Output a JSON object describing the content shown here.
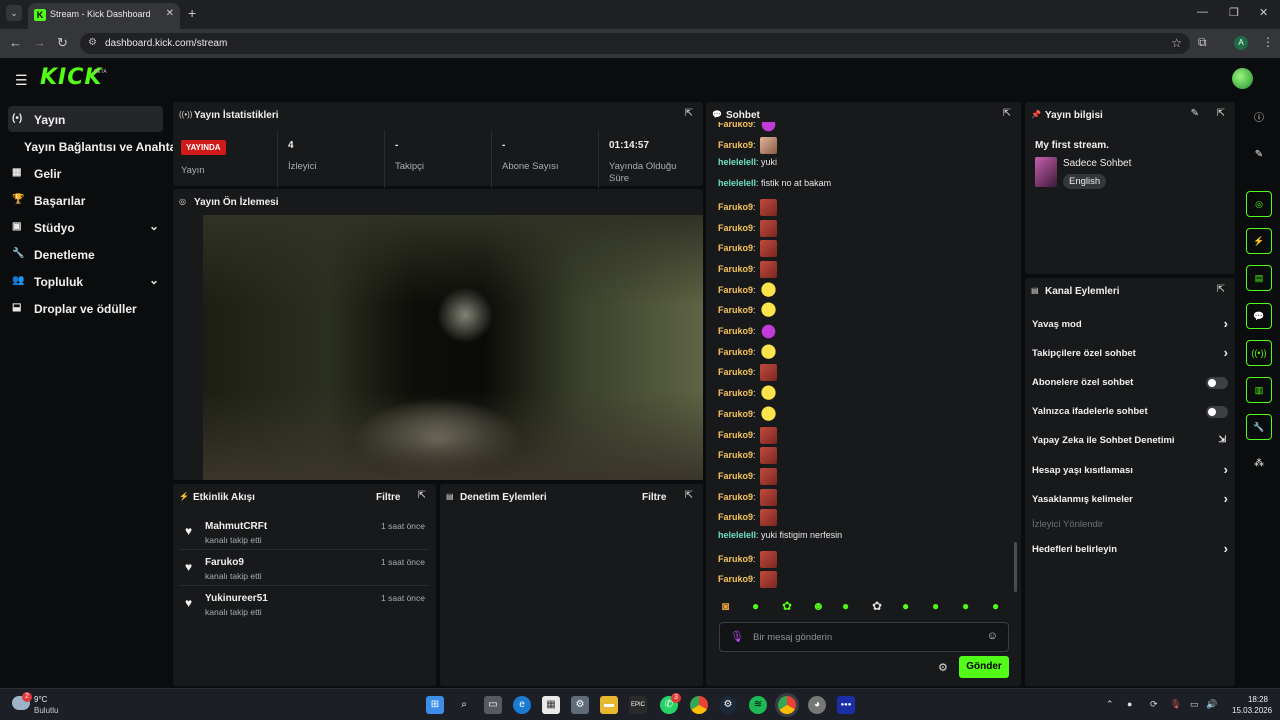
{
  "browser": {
    "tab_title": "Stream - Kick Dashboard",
    "url": "dashboard.kick.com/stream",
    "profile_initial": "A"
  },
  "brand": {
    "logo": "KICK",
    "beta": "BETA",
    "accent": "#53fc18"
  },
  "sidebar": {
    "items": [
      {
        "label": "Yayın",
        "icon": "broadcast-icon",
        "active": true
      },
      {
        "label": "Yayın Bağlantısı ve Anahtarı",
        "icon": "",
        "active": false
      },
      {
        "label": "Gelir",
        "icon": "revenue-icon",
        "active": false
      },
      {
        "label": "Başarılar",
        "icon": "trophy-icon",
        "active": false
      },
      {
        "label": "Stüdyo",
        "icon": "studio-icon",
        "active": false,
        "expandable": true
      },
      {
        "label": "Denetleme",
        "icon": "wrench-icon",
        "active": false
      },
      {
        "label": "Topluluk",
        "icon": "community-icon",
        "active": false,
        "expandable": true
      },
      {
        "label": "Droplar ve ödüller",
        "icon": "gift-icon",
        "active": false
      }
    ]
  },
  "stats": {
    "title": "Yayın İstatistikleri",
    "live_badge": "YAYINDA",
    "live_label": "Yayın",
    "cells": [
      {
        "value": "4",
        "label": "İzleyici"
      },
      {
        "value": "-",
        "label": "Takipçi"
      },
      {
        "value": "-",
        "label": "Abone Sayısı"
      },
      {
        "value": "01:14:57",
        "label": "Yayında Olduğu Süre"
      }
    ]
  },
  "preview": {
    "title": "Yayın Ön İzlemesi"
  },
  "activity": {
    "title": "Etkinlik Akışı",
    "filter": "Filtre",
    "events": [
      {
        "name": "MahmutCRFt",
        "action": "kanalı takip etti",
        "time": "1 saat önce"
      },
      {
        "name": "Faruko9",
        "action": "kanalı takip etti",
        "time": "1 saat önce"
      },
      {
        "name": "Yukinureer51",
        "action": "kanalı takip etti",
        "time": "1 saat önce"
      }
    ]
  },
  "moderation": {
    "title": "Denetim Eylemleri",
    "filter": "Filtre"
  },
  "chat": {
    "title": "Sohbet",
    "messages": [
      {
        "user": "Faruko9",
        "type": "f",
        "text": "",
        "emote": "em-pink"
      },
      {
        "user": "Faruko9",
        "type": "f",
        "text": "",
        "emote": "em-face"
      },
      {
        "user": "helelelell",
        "type": "h",
        "text": "yuki",
        "emote": ""
      },
      {
        "user": "helelelell",
        "type": "h",
        "text": "fistik no at bakam",
        "emote": ""
      },
      {
        "user": "Faruko9",
        "type": "f",
        "text": "",
        "emote": "em-cat"
      },
      {
        "user": "Faruko9",
        "type": "f",
        "text": "",
        "emote": "em-cat"
      },
      {
        "user": "Faruko9",
        "type": "f",
        "text": "",
        "emote": "em-cat"
      },
      {
        "user": "Faruko9",
        "type": "f",
        "text": "",
        "emote": "em-cat"
      },
      {
        "user": "Faruko9",
        "type": "f",
        "text": "",
        "emote": "em-blob"
      },
      {
        "user": "Faruko9",
        "type": "f",
        "text": "",
        "emote": "em-blob"
      },
      {
        "user": "Faruko9",
        "type": "f",
        "text": "",
        "emote": "em-pink"
      },
      {
        "user": "Faruko9",
        "type": "f",
        "text": "",
        "emote": "em-blob"
      },
      {
        "user": "Faruko9",
        "type": "f",
        "text": "",
        "emote": "em-cat"
      },
      {
        "user": "Faruko9",
        "type": "f",
        "text": "",
        "emote": "em-blob"
      },
      {
        "user": "Faruko9",
        "type": "f",
        "text": "",
        "emote": "em-blob"
      },
      {
        "user": "Faruko9",
        "type": "f",
        "text": "",
        "emote": "em-cat"
      },
      {
        "user": "Faruko9",
        "type": "f",
        "text": "",
        "emote": "em-cat"
      },
      {
        "user": "Faruko9",
        "type": "f",
        "text": "",
        "emote": "em-cat"
      },
      {
        "user": "Faruko9",
        "type": "f",
        "text": "",
        "emote": "em-cat"
      },
      {
        "user": "Faruko9",
        "type": "f",
        "text": "",
        "emote": "em-cat"
      },
      {
        "user": "helelelell",
        "type": "h",
        "text": "yuki fistigim nerfesin",
        "emote": ""
      },
      {
        "user": "Faruko9",
        "type": "f",
        "text": "",
        "emote": "em-cat"
      },
      {
        "user": "Faruko9",
        "type": "f",
        "text": "",
        "emote": "em-cat"
      }
    ],
    "input_placeholder": "Bir mesaj gönderin",
    "send": "Gönder"
  },
  "info": {
    "title": "Yayın bilgisi",
    "stream_title": "My first stream.",
    "category": "Sadece Sohbet",
    "language": "English"
  },
  "channel_actions": {
    "title": "Kanal Eylemleri",
    "items": [
      {
        "label": "Yavaş mod",
        "control": "arrow"
      },
      {
        "label": "Takipçilere özel sohbet",
        "control": "arrow"
      },
      {
        "label": "Abonelere özel sohbet",
        "control": "toggle"
      },
      {
        "label": "Yalnızca ifadelerle sohbet",
        "control": "toggle"
      },
      {
        "label": "Yapay Zeka ile Sohbet Denetimi",
        "control": "external"
      },
      {
        "label": "Hesap yaşı kısıtlaması",
        "control": "arrow"
      },
      {
        "label": "Yasaklanmış kelimeler",
        "control": "arrow"
      },
      {
        "label": "İzleyici Yönlendir",
        "control": "disabled"
      },
      {
        "label": "Hedefleri belirleyin",
        "control": "arrow"
      }
    ]
  },
  "taskbar": {
    "temperature": "9°C",
    "weather": "Bulutlu",
    "weather_badge": "2",
    "whatsapp_badge": "3",
    "time": "18:28",
    "date": "15.03.2026"
  }
}
